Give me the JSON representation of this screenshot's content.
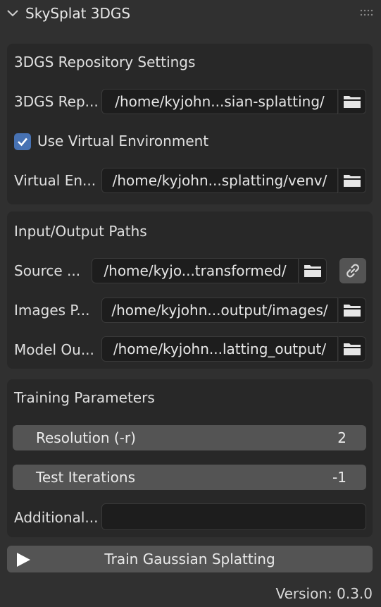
{
  "panel": {
    "title": "SkySplat 3DGS"
  },
  "repo": {
    "title": "3DGS Repository Settings",
    "repo_label": "3DGS Rep...",
    "repo_path": "/home/kyjohn...sian-splatting/",
    "use_venv_label": "Use Virtual Environment",
    "use_venv_checked": true,
    "venv_label": "Virtual En...",
    "venv_path": "/home/kyjohn...splatting/venv/"
  },
  "io": {
    "title": "Input/Output Paths",
    "source_label": "Source ...",
    "source_path": "/home/kyjo...transformed/",
    "images_label": "Images P...",
    "images_path": "/home/kyjohn...output/images/",
    "model_label": "Model Ou...",
    "model_path": "/home/kyjohn...latting_output/"
  },
  "training": {
    "title": "Training Parameters",
    "resolution_label": "Resolution (-r)",
    "resolution_value": "2",
    "test_iter_label": "Test Iterations",
    "test_iter_value": "-1",
    "additional_label": "Additional...",
    "additional_value": ""
  },
  "train_button": {
    "label": "Train Gaussian Splatting"
  },
  "version": "Version: 0.3.0",
  "colors": {
    "accent": "#4772b3",
    "panel_bg": "#303030",
    "box_bg": "#282828",
    "field_bg": "#1d1d1d",
    "button_bg": "#545454"
  },
  "icons": {
    "collapse": "chevron-down-icon",
    "drag": "grip-icon",
    "browse": "folder-icon",
    "link": "link-icon",
    "run": "play-icon",
    "check": "checkmark-icon"
  }
}
